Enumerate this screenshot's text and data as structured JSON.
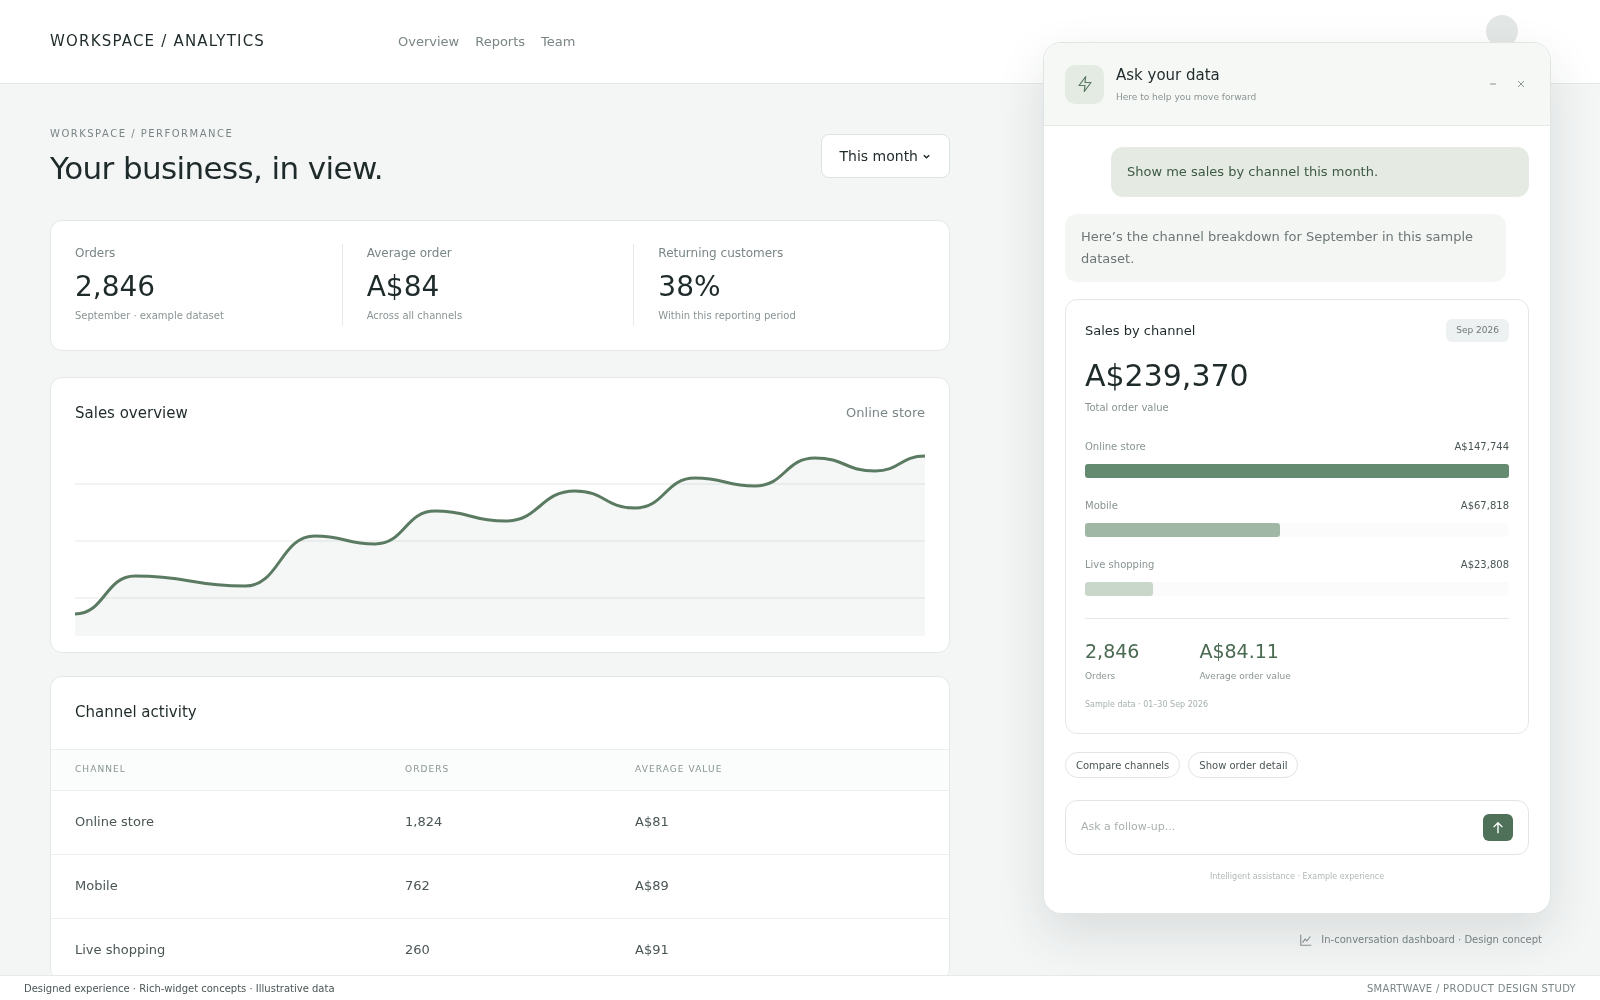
{
  "header": {
    "brand": "WORKSPACE / ANALYTICS",
    "nav": [
      {
        "label": "Overview",
        "selected": false
      },
      {
        "label": "Reports",
        "selected": false
      },
      {
        "label": "Team",
        "selected": false
      }
    ]
  },
  "page": {
    "breadcrumb": "WORKSPACE / PERFORMANCE",
    "title": "Your business, in view.",
    "period_button": "This month"
  },
  "stats": [
    {
      "label": "Orders",
      "value": "2,846",
      "note": "September · example dataset"
    },
    {
      "label": "Average order",
      "value": "A$84",
      "note": "Across all channels"
    },
    {
      "label": "Returning customers",
      "value": "38%",
      "note": "Within this reporting period"
    }
  ],
  "sales_overview": {
    "title": "Sales overview",
    "filter": "Online store"
  },
  "channel_activity": {
    "title": "Channel activity",
    "columns": [
      "CHANNEL",
      "ORDERS",
      "AVERAGE VALUE"
    ],
    "rows": [
      [
        "Online store",
        "1,824",
        "A$81"
      ],
      [
        "Mobile",
        "762",
        "A$89"
      ],
      [
        "Live shopping",
        "260",
        "A$91"
      ]
    ]
  },
  "assistant": {
    "title": "Ask your data",
    "subtitle": "Here to help you move forward",
    "messages": [
      {
        "kind": "user",
        "text": "Show me sales by channel this month."
      },
      {
        "kind": "assistant",
        "text": "Here’s the channel breakdown for September in this sample dataset."
      }
    ],
    "card": {
      "title": "Sales by channel",
      "badge": "Sep 2026",
      "total": "A$239,370",
      "total_label": "Total order value",
      "channels": [
        {
          "name": "Online store",
          "value": "A$147,744",
          "level": 1,
          "color": "#648a70"
        },
        {
          "name": "Mobile",
          "value": "A$67,818",
          "level": 0.46,
          "color": "#a1b7a5"
        },
        {
          "name": "Live shopping",
          "value": "A$23,808",
          "level": 0.16,
          "color": "#c9d7cb"
        }
      ],
      "metrics": [
        {
          "value": "2,846",
          "label": "Orders"
        },
        {
          "value": "A$84.11",
          "label": "Average order value"
        }
      ],
      "note": "Sample data · 01–30 Sep 2026"
    },
    "chips": [
      "Compare channels",
      "Show order detail"
    ],
    "input": {
      "placeholder": "Ask a follow-up..."
    },
    "footer": "Intelligent assistance · Example experience"
  },
  "caption": "In-conversation dashboard · Design concept",
  "footer": {
    "left": "Designed experience · Rich-widget concepts · Illustrative data",
    "right": "SMARTWAVE / PRODUCT DESIGN STUDY"
  }
}
